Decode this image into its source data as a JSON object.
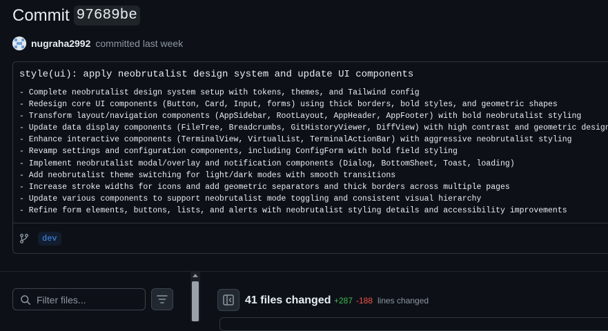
{
  "header": {
    "title": "Commit",
    "sha": "97689be"
  },
  "meta": {
    "author": "nugraha2992",
    "action": "committed last week"
  },
  "commit_message": {
    "headline": "style(ui): apply neobrutalist design system and update UI components",
    "body": [
      "- Complete neobrutalist design system setup with tokens, themes, and Tailwind config",
      "- Redesign core UI components (Button, Card, Input, forms) using thick borders, bold styles, and geometric shapes",
      "- Transform layout/navigation components (AppSidebar, RootLayout, AppHeader, AppFooter) with bold neobrutalist styling",
      "- Update data display components (FileTree, Breadcrumbs, GitHistoryViewer, DiffView) with high contrast and geometric design",
      "- Enhance interactive components (TerminalView, VirtualList, TerminalActionBar) with aggressive neobrutalist styling",
      "- Revamp settings and configuration components, including ConfigForm with bold field styling",
      "- Implement neobrutalist modal/overlay and notification components (Dialog, BottomSheet, Toast, loading)",
      "- Add neobrutalist theme switching for light/dark modes with smooth transitions",
      "- Increase stroke widths for icons and add geometric separators and thick borders across multiple pages",
      "- Update various components to support neobrutalist mode toggling and consistent visual hierarchy",
      "- Refine form elements, buttons, lists, and alerts with neobrutalist styling details and accessibility improvements"
    ]
  },
  "branch": {
    "icon": "git-branch-icon",
    "name": "dev"
  },
  "file_filter": {
    "placeholder": "Filter files...",
    "value": ""
  },
  "summary": {
    "files_changed": "41 files changed",
    "additions": "+287",
    "deletions": "-188",
    "lines_changed": "lines changed"
  },
  "colors": {
    "background": "#0d1117",
    "border": "#30363d",
    "accent": "#4493f8",
    "addition": "#3fb950",
    "deletion": "#f85149"
  }
}
